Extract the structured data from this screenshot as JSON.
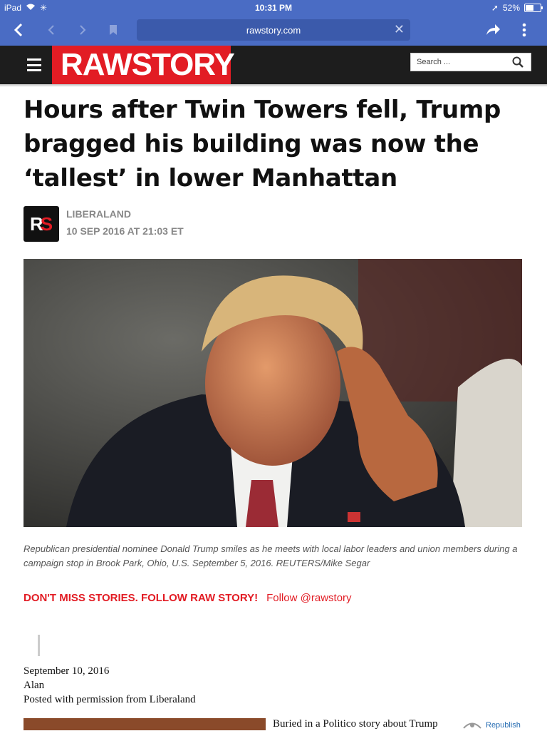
{
  "status_bar": {
    "device": "iPad",
    "time": "10:31 PM",
    "battery": "52%",
    "battery_level": 0.52
  },
  "browser": {
    "url": "rawstory.com"
  },
  "site": {
    "logo_part1": "RAW",
    "logo_part2": "STORY",
    "search_placeholder": "Search ...",
    "brand_color": "#e21c24"
  },
  "article": {
    "headline": "Hours after Twin Towers fell, Trump bragged his building was now the ‘tallest’ in lower Manhattan",
    "byline_logo_r": "R",
    "byline_logo_s": "S",
    "author": "LIBERALAND",
    "date": "10 SEP 2016 AT 21:03 ET",
    "caption": "Republican presidential nominee Donald Trump smiles as he meets with local labor leaders and union members during a campaign stop in Brook Park, Ohio, U.S. September 5, 2016. REUTERS/Mike Segar",
    "follow_cta": "DON'T MISS STORIES. FOLLOW RAW STORY!",
    "follow_handle": "Follow @rawstory",
    "body_line1": "September 10, 2016",
    "body_line2": "Alan",
    "body_line3": "Posted with permission from Liberaland",
    "teaser": "Buried in a Politico story about Trump",
    "republish": "Republish"
  }
}
